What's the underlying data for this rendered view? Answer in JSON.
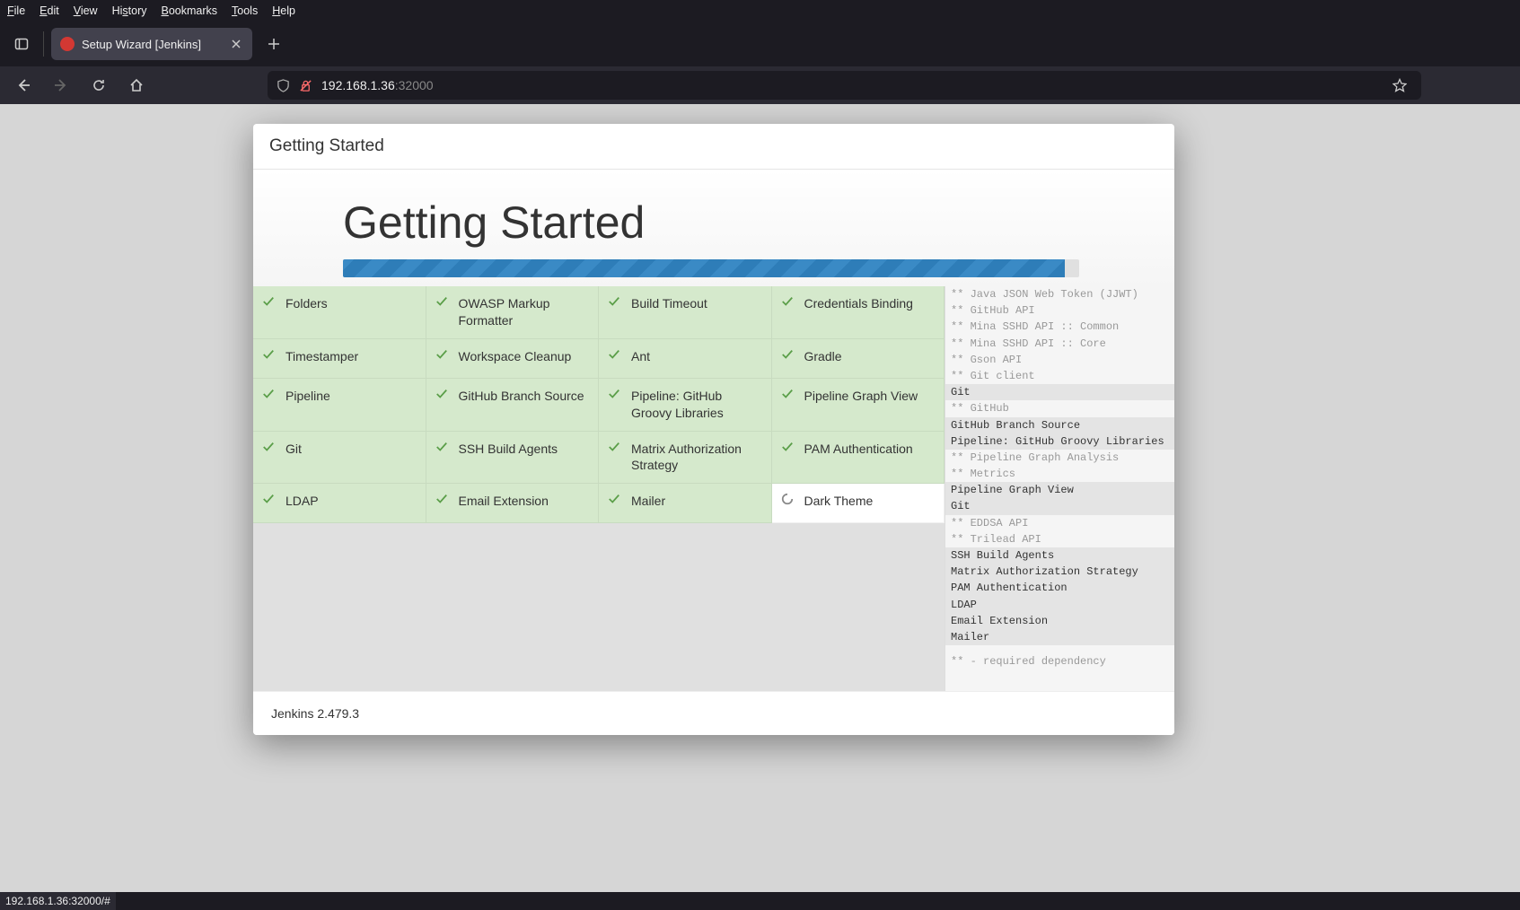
{
  "menubar": {
    "file": "File",
    "edit": "Edit",
    "view": "View",
    "history": "History",
    "bookmarks": "Bookmarks",
    "tools": "Tools",
    "help": "Help"
  },
  "tab": {
    "title": "Setup Wizard [Jenkins]"
  },
  "url": {
    "host": "192.168.1.36",
    "port": ":32000"
  },
  "dialog": {
    "breadcrumb": "Getting Started",
    "title": "Getting Started",
    "progress_pct": 98
  },
  "plugins": [
    {
      "name": "Folders",
      "status": "done"
    },
    {
      "name": "OWASP Markup Formatter",
      "status": "done"
    },
    {
      "name": "Build Timeout",
      "status": "done"
    },
    {
      "name": "Credentials Binding",
      "status": "done"
    },
    {
      "name": "Timestamper",
      "status": "done"
    },
    {
      "name": "Workspace Cleanup",
      "status": "done"
    },
    {
      "name": "Ant",
      "status": "done"
    },
    {
      "name": "Gradle",
      "status": "done"
    },
    {
      "name": "Pipeline",
      "status": "done"
    },
    {
      "name": "GitHub Branch Source",
      "status": "done"
    },
    {
      "name": "Pipeline: GitHub Groovy Libraries",
      "status": "done"
    },
    {
      "name": "Pipeline Graph View",
      "status": "done"
    },
    {
      "name": "Git",
      "status": "done"
    },
    {
      "name": "SSH Build Agents",
      "status": "done"
    },
    {
      "name": "Matrix Authorization Strategy",
      "status": "done"
    },
    {
      "name": "PAM Authentication",
      "status": "done"
    },
    {
      "name": "LDAP",
      "status": "done"
    },
    {
      "name": "Email Extension",
      "status": "done"
    },
    {
      "name": "Mailer",
      "status": "done"
    },
    {
      "name": "Dark Theme",
      "status": "loading"
    }
  ],
  "log": [
    {
      "t": "** Java JSON Web Token (JJWT)",
      "c": "dep"
    },
    {
      "t": "** GitHub API",
      "c": "dep"
    },
    {
      "t": "** Mina SSHD API :: Common",
      "c": "dep"
    },
    {
      "t": "** Mina SSHD API :: Core",
      "c": "dep"
    },
    {
      "t": "** Gson API",
      "c": "dep"
    },
    {
      "t": "** Git client",
      "c": "dep"
    },
    {
      "t": "Git",
      "c": "main"
    },
    {
      "t": "** GitHub",
      "c": "dep"
    },
    {
      "t": "GitHub Branch Source",
      "c": "main"
    },
    {
      "t": "Pipeline: GitHub Groovy Libraries",
      "c": "main"
    },
    {
      "t": "** Pipeline Graph Analysis",
      "c": "dep"
    },
    {
      "t": "** Metrics",
      "c": "dep"
    },
    {
      "t": "Pipeline Graph View",
      "c": "main"
    },
    {
      "t": "Git",
      "c": "main"
    },
    {
      "t": "** EDDSA API",
      "c": "dep"
    },
    {
      "t": "** Trilead API",
      "c": "dep"
    },
    {
      "t": "SSH Build Agents",
      "c": "main"
    },
    {
      "t": "Matrix Authorization Strategy",
      "c": "main"
    },
    {
      "t": "PAM Authentication",
      "c": "main"
    },
    {
      "t": "LDAP",
      "c": "main"
    },
    {
      "t": "Email Extension",
      "c": "main"
    },
    {
      "t": "Mailer",
      "c": "main"
    }
  ],
  "log_footer": "** - required dependency",
  "footer": {
    "version": "Jenkins 2.479.3"
  },
  "statusbar": {
    "text": "192.168.1.36:32000/#"
  }
}
